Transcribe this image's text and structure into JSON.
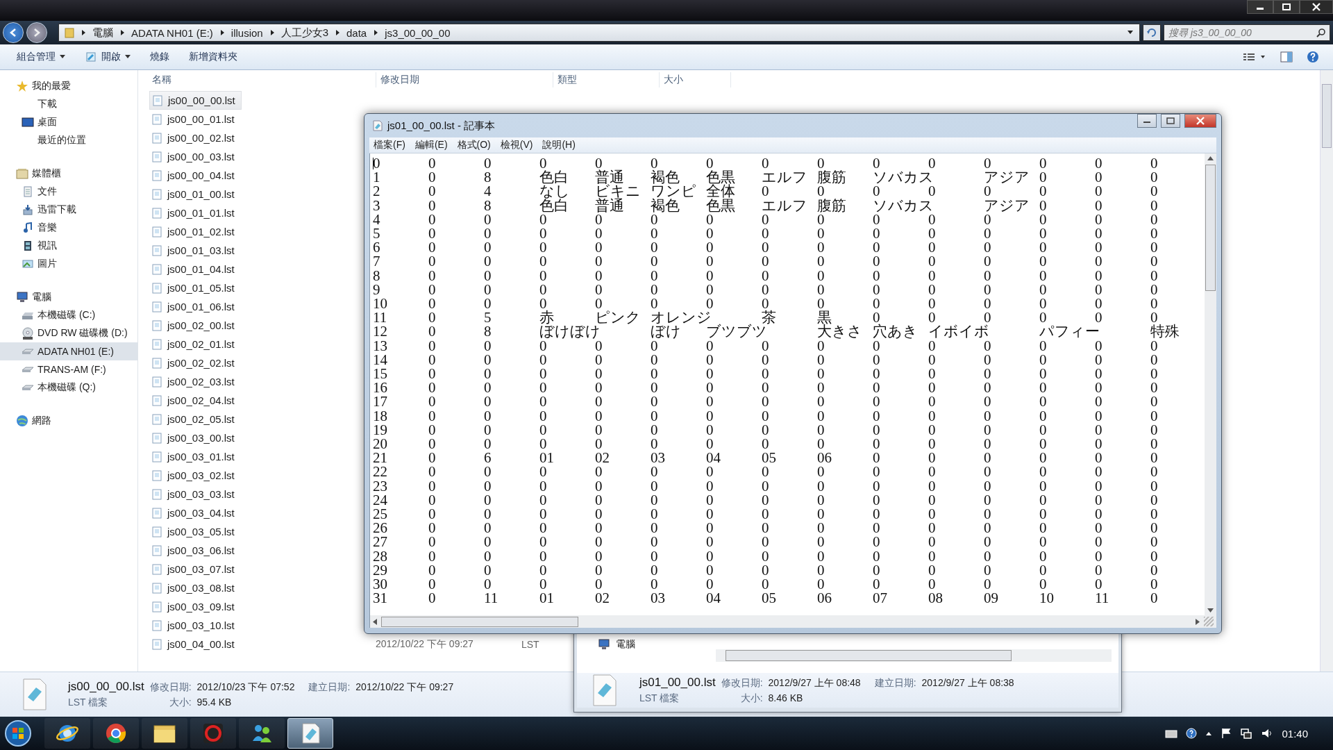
{
  "explorer": {
    "breadcrumb": [
      "電腦",
      "ADATA NH01 (E:)",
      "illusion",
      "人工少女3",
      "data",
      "js3_00_00_00"
    ],
    "search": {
      "placeholder": "搜尋 js3_00_00_00"
    },
    "toolbar": [
      {
        "label": "組合管理",
        "dropdown": true
      },
      {
        "label": "開啟",
        "dropdown": true
      },
      {
        "label": "燒錄",
        "dropdown": false
      },
      {
        "label": "新增資料夾",
        "dropdown": false
      }
    ],
    "sidebar": [
      {
        "label": "我的最愛",
        "kind": "star",
        "selected": false,
        "children": [
          {
            "label": "下載",
            "kind": "blank",
            "selected": false
          },
          {
            "label": "桌面",
            "kind": "desktop",
            "selected": false
          },
          {
            "label": "最近的位置",
            "kind": "blank",
            "selected": false
          }
        ]
      },
      {
        "label": "媒體櫃",
        "kind": "library",
        "selected": false,
        "children": [
          {
            "label": "文件",
            "kind": "document",
            "selected": false
          },
          {
            "label": "迅雷下載",
            "kind": "download",
            "selected": false
          },
          {
            "label": "音樂",
            "kind": "music",
            "selected": false
          },
          {
            "label": "視訊",
            "kind": "video",
            "selected": false
          },
          {
            "label": "圖片",
            "kind": "picture",
            "selected": false
          }
        ]
      },
      {
        "label": "電腦",
        "kind": "computer",
        "selected": false,
        "children": [
          {
            "label": "本機磁碟 (C:)",
            "kind": "drive",
            "selected": false
          },
          {
            "label": "DVD RW 磁碟機 (D:)",
            "kind": "disc",
            "selected": false
          },
          {
            "label": "ADATA NH01 (E:)",
            "kind": "removable",
            "selected": true
          },
          {
            "label": "TRANS-AM (F:)",
            "kind": "removable",
            "selected": false
          },
          {
            "label": "本機磁碟 (Q:)",
            "kind": "removable",
            "selected": false
          }
        ]
      },
      {
        "label": "網路",
        "kind": "network",
        "selected": false
      }
    ],
    "columns": [
      "名稱",
      "修改日期",
      "類型",
      "大小"
    ],
    "files": [
      {
        "name": "js00_00_00.lst",
        "selected": true
      },
      {
        "name": "js00_00_01.lst",
        "selected": false
      },
      {
        "name": "js00_00_02.lst",
        "selected": false
      },
      {
        "name": "js00_00_03.lst",
        "selected": false
      },
      {
        "name": "js00_00_04.lst",
        "selected": false
      },
      {
        "name": "js00_01_00.lst",
        "selected": false
      },
      {
        "name": "js00_01_01.lst",
        "selected": false
      },
      {
        "name": "js00_01_02.lst",
        "selected": false
      },
      {
        "name": "js00_01_03.lst",
        "selected": false
      },
      {
        "name": "js00_01_04.lst",
        "selected": false
      },
      {
        "name": "js00_01_05.lst",
        "selected": false
      },
      {
        "name": "js00_01_06.lst",
        "selected": false
      },
      {
        "name": "js00_02_00.lst",
        "selected": false
      },
      {
        "name": "js00_02_01.lst",
        "selected": false
      },
      {
        "name": "js00_02_02.lst",
        "selected": false
      },
      {
        "name": "js00_02_03.lst",
        "selected": false
      },
      {
        "name": "js00_02_04.lst",
        "selected": false
      },
      {
        "name": "js00_02_05.lst",
        "selected": false
      },
      {
        "name": "js00_03_00.lst",
        "selected": false
      },
      {
        "name": "js00_03_01.lst",
        "selected": false
      },
      {
        "name": "js00_03_02.lst",
        "selected": false
      },
      {
        "name": "js00_03_03.lst",
        "selected": false
      },
      {
        "name": "js00_03_04.lst",
        "selected": false
      },
      {
        "name": "js00_03_05.lst",
        "selected": false
      },
      {
        "name": "js00_03_06.lst",
        "selected": false
      },
      {
        "name": "js00_03_07.lst",
        "selected": false
      },
      {
        "name": "js00_03_08.lst",
        "selected": false
      },
      {
        "name": "js00_03_09.lst",
        "selected": false
      },
      {
        "name": "js00_03_10.lst",
        "selected": false
      },
      {
        "name": "js00_04_00.lst",
        "selected": false,
        "date": "2012/10/22 下午 09:27",
        "type": "LST"
      }
    ],
    "details": {
      "name": "js00_00_00.lst",
      "type": "LST 檔案",
      "modified_label": "修改日期:",
      "modified": "2012/10/23 下午 07:52",
      "created_label": "建立日期:",
      "created": "2012/10/22 下午 09:27",
      "size_label": "大小:",
      "size": "95.4 KB"
    }
  },
  "notepad": {
    "title": "js01_00_00.lst - 記事本",
    "menu": [
      "檔案(F)",
      "編輯(E)",
      "格式(O)",
      "檢視(V)",
      "說明(H)"
    ],
    "lines": [
      "0\t0\t0\t0\t0\t0\t0\t0\t0\t0\t0\t0\t0\t0\t0",
      "1\t0\t8\t色白\t普通\t褐色\t色黒\tエルフ\t腹筋\tソバカス\tアジア\t0\t0\t0",
      "2\t0\t4\tなし\tビキニ\tワンピ\t全体\t0\t0\t0\t0\t0\t0\t0\t0",
      "3\t0\t8\t色白\t普通\t褐色\t色黒\tエルフ\t腹筋\tソバカス\tアジア\t0\t0\t0",
      "4\t0\t0\t0\t0\t0\t0\t0\t0\t0\t0\t0\t0\t0\t0",
      "5\t0\t0\t0\t0\t0\t0\t0\t0\t0\t0\t0\t0\t0\t0",
      "6\t0\t0\t0\t0\t0\t0\t0\t0\t0\t0\t0\t0\t0\t0",
      "7\t0\t0\t0\t0\t0\t0\t0\t0\t0\t0\t0\t0\t0\t0",
      "8\t0\t0\t0\t0\t0\t0\t0\t0\t0\t0\t0\t0\t0\t0",
      "9\t0\t0\t0\t0\t0\t0\t0\t0\t0\t0\t0\t0\t0\t0",
      "10\t0\t0\t0\t0\t0\t0\t0\t0\t0\t0\t0\t0\t0\t0",
      "11\t0\t5\t赤\tピンク\tオレンジ\t茶\t黒\t0\t0\t0\t0\t0\t0",
      "12\t0\t8\tぼけぼけ\tぼけ\tブツブツ\t大きさ\t穴あき\tイボイボ\tパフィー\t特殊",
      "13\t0\t0\t0\t0\t0\t0\t0\t0\t0\t0\t0\t0\t0\t0",
      "14\t0\t0\t0\t0\t0\t0\t0\t0\t0\t0\t0\t0\t0\t0",
      "15\t0\t0\t0\t0\t0\t0\t0\t0\t0\t0\t0\t0\t0\t0",
      "16\t0\t0\t0\t0\t0\t0\t0\t0\t0\t0\t0\t0\t0\t0",
      "17\t0\t0\t0\t0\t0\t0\t0\t0\t0\t0\t0\t0\t0\t0",
      "18\t0\t0\t0\t0\t0\t0\t0\t0\t0\t0\t0\t0\t0\t0",
      "19\t0\t0\t0\t0\t0\t0\t0\t0\t0\t0\t0\t0\t0\t0",
      "20\t0\t0\t0\t0\t0\t0\t0\t0\t0\t0\t0\t0\t0\t0",
      "21\t0\t6\t01\t02\t03\t04\t05\t06\t0\t0\t0\t0\t0\t0",
      "22\t0\t0\t0\t0\t0\t0\t0\t0\t0\t0\t0\t0\t0\t0",
      "23\t0\t0\t0\t0\t0\t0\t0\t0\t0\t0\t0\t0\t0\t0",
      "24\t0\t0\t0\t0\t0\t0\t0\t0\t0\t0\t0\t0\t0\t0",
      "25\t0\t0\t0\t0\t0\t0\t0\t0\t0\t0\t0\t0\t0\t0",
      "26\t0\t0\t0\t0\t0\t0\t0\t0\t0\t0\t0\t0\t0\t0",
      "27\t0\t0\t0\t0\t0\t0\t0\t0\t0\t0\t0\t0\t0\t0",
      "28\t0\t0\t0\t0\t0\t0\t0\t0\t0\t0\t0\t0\t0\t0",
      "29\t0\t0\t0\t0\t0\t0\t0\t0\t0\t0\t0\t0\t0\t0",
      "30\t0\t0\t0\t0\t0\t0\t0\t0\t0\t0\t0\t0\t0\t0",
      "31\t0\t11\t01\t02\t03\t04\t05\t06\t07\t08\t09\t10\t11\t0"
    ]
  },
  "back_window": {
    "nav_item": "電腦",
    "details": {
      "name": "js01_00_00.lst",
      "type": "LST 檔案",
      "modified_label": "修改日期:",
      "modified": "2012/9/27 上午 08:48",
      "created_label": "建立日期:",
      "created": "2012/9/27 上午 08:38",
      "size_label": "大小:",
      "size": "8.46 KB"
    }
  },
  "taskbar": {
    "apps": [
      {
        "kind": "browser",
        "selected": false
      },
      {
        "kind": "chrome",
        "selected": false
      },
      {
        "kind": "folder",
        "selected": false
      },
      {
        "kind": "red",
        "selected": false
      },
      {
        "kind": "people",
        "selected": false
      },
      {
        "kind": "notepad",
        "selected": true
      }
    ],
    "clock": "01:40"
  }
}
